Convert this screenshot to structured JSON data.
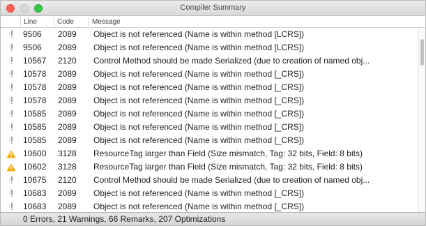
{
  "window": {
    "title": "Compiler Summary"
  },
  "columns": {
    "line": "Line",
    "code": "Code",
    "message": "Message"
  },
  "colors": {
    "info_icon": "#9b9b9b",
    "warning_icon": "#f2a900"
  },
  "rows": [
    {
      "kind": "remark-icon",
      "line": "9506",
      "code": "2089",
      "message": "Object is not referenced (Name is within method [LCRS])"
    },
    {
      "kind": "remark-icon",
      "line": "9506",
      "code": "2089",
      "message": "Object is not referenced (Name is within method [LCRS])"
    },
    {
      "kind": "remark-icon",
      "line": "10567",
      "code": "2120",
      "message": "Control Method should be made Serialized (due to creation of named obj..."
    },
    {
      "kind": "remark-icon",
      "line": "10578",
      "code": "2089",
      "message": "Object is not referenced (Name is within method [_CRS])"
    },
    {
      "kind": "remark-icon",
      "line": "10578",
      "code": "2089",
      "message": "Object is not referenced (Name is within method [_CRS])"
    },
    {
      "kind": "remark-icon",
      "line": "10578",
      "code": "2089",
      "message": "Object is not referenced (Name is within method [_CRS])"
    },
    {
      "kind": "remark-icon",
      "line": "10585",
      "code": "2089",
      "message": "Object is not referenced (Name is within method [_CRS])"
    },
    {
      "kind": "remark-icon",
      "line": "10585",
      "code": "2089",
      "message": "Object is not referenced (Name is within method [_CRS])"
    },
    {
      "kind": "remark-icon",
      "line": "10585",
      "code": "2089",
      "message": "Object is not referenced (Name is within method [_CRS])"
    },
    {
      "kind": "warning-icon",
      "line": "10600",
      "code": "3128",
      "message": "ResourceTag larger than Field (Size mismatch, Tag: 32 bits, Field: 8 bits)"
    },
    {
      "kind": "warning-icon",
      "line": "10602",
      "code": "3128",
      "message": "ResourceTag larger than Field (Size mismatch, Tag: 32 bits, Field: 8 bits)"
    },
    {
      "kind": "remark-icon",
      "line": "10675",
      "code": "2120",
      "message": "Control Method should be made Serialized (due to creation of named obj..."
    },
    {
      "kind": "remark-icon",
      "line": "10683",
      "code": "2089",
      "message": "Object is not referenced (Name is within method [_CRS])"
    },
    {
      "kind": "remark-icon",
      "line": "10683",
      "code": "2089",
      "message": "Object is not referenced (Name is within method [_CRS])"
    }
  ],
  "status": {
    "summary": "0 Errors, 21 Warnings, 66 Remarks, 207 Optimizations"
  }
}
